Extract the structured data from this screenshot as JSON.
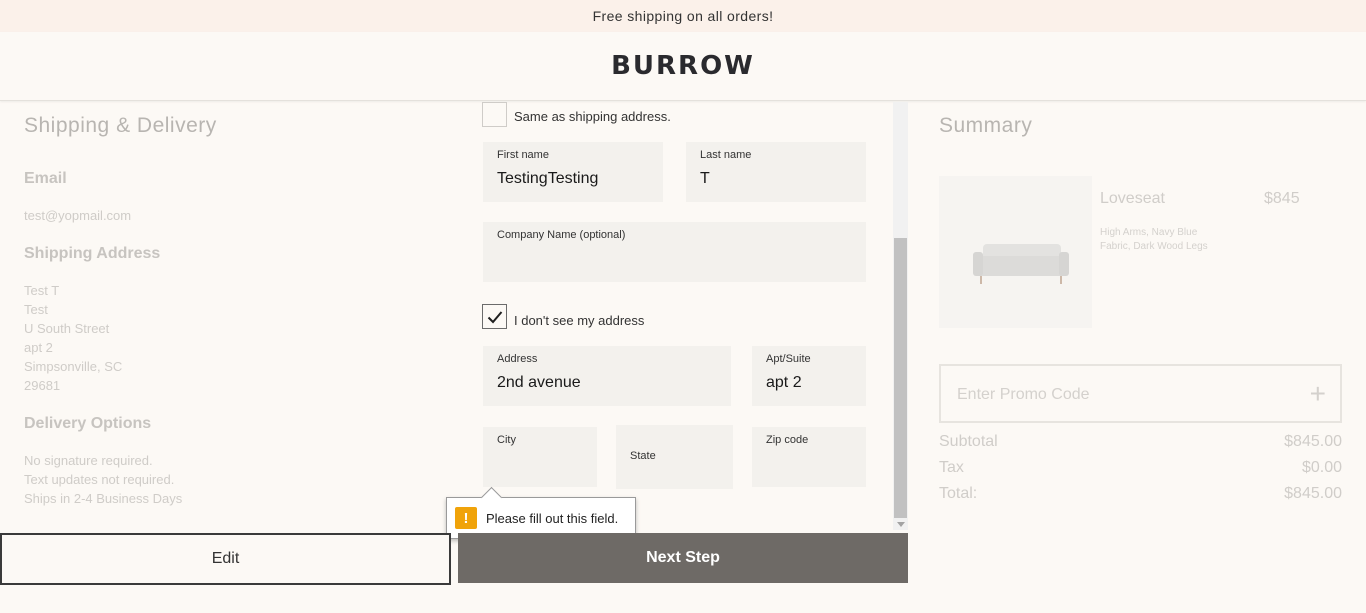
{
  "promo_bar": {
    "text": "Free shipping on all orders!"
  },
  "header": {
    "logo": "BURROW"
  },
  "left": {
    "title": "Shipping & Delivery",
    "email_heading": "Email",
    "email_value": "test@yopmail.com",
    "address_heading": "Shipping Address",
    "address_lines": [
      "Test T",
      "Test",
      "U South Street",
      "apt 2",
      "Simpsonville, SC",
      "29681"
    ],
    "delivery_heading": "Delivery Options",
    "delivery_lines": [
      "No signature required.",
      "Text updates not required.",
      "Ships in 2-4 Business Days"
    ]
  },
  "form": {
    "same_as_shipping_label": "Same as shipping address.",
    "first_name": {
      "label": "First name",
      "value": "TestingTesting"
    },
    "last_name": {
      "label": "Last name",
      "value": "T"
    },
    "company": {
      "label": "Company Name (optional)",
      "value": ""
    },
    "no_address_label": "I don't see my address",
    "address": {
      "label": "Address",
      "value": "2nd avenue"
    },
    "apt": {
      "label": "Apt/Suite",
      "value": "apt 2"
    },
    "city": {
      "label": "City",
      "value": ""
    },
    "state": {
      "label": "State",
      "value": ""
    },
    "zip": {
      "label": "Zip code",
      "value": ""
    },
    "validation_message": "Please fill out this field."
  },
  "buttons": {
    "edit": "Edit",
    "next": "Next Step"
  },
  "summary": {
    "title": "Summary",
    "product": {
      "name": "Loveseat",
      "price": "$845",
      "description": "High Arms, Navy Blue Fabric, Dark Wood Legs"
    },
    "promo_placeholder": "Enter Promo Code",
    "subtotal_label": "Subtotal",
    "subtotal_value": "$845.00",
    "tax_label": "Tax",
    "tax_value": "$0.00",
    "total_label": "Total:",
    "total_value": "$845.00"
  },
  "colors": {
    "accent_button": "#6e6a66",
    "warning": "#f0a30a",
    "background": "#fcf9f5",
    "field_bg": "#f3f1ed"
  }
}
